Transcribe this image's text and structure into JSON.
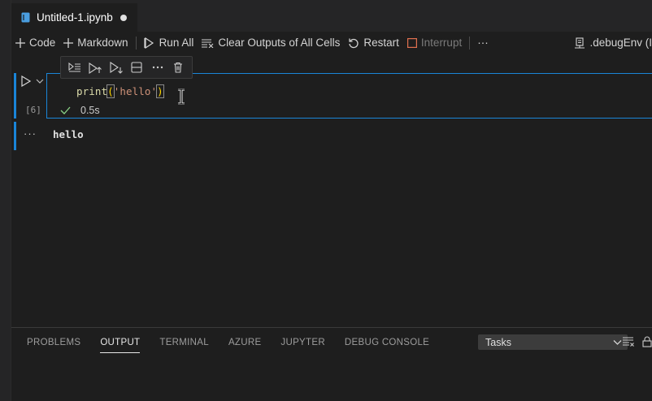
{
  "tab": {
    "title": "Untitled-1.ipynb"
  },
  "toolbar": {
    "code_label": "Code",
    "markdown_label": "Markdown",
    "run_all_label": "Run All",
    "clear_outputs_label": "Clear Outputs of All Cells",
    "restart_label": "Restart",
    "interrupt_label": "Interrupt",
    "more_label": "···",
    "kernel_label": ".debugEnv (I"
  },
  "cell": {
    "code_fn": "print",
    "code_open": "(",
    "code_str": "'hello'",
    "code_close": ")",
    "exec_count": "[6]",
    "duration": "0.5s",
    "output_dots": "···",
    "output": "hello"
  },
  "panel": {
    "tabs": [
      "PROBLEMS",
      "OUTPUT",
      "TERMINAL",
      "AZURE",
      "JUPYTER",
      "DEBUG CONSOLE"
    ],
    "active_tab": "OUTPUT",
    "tasks_value": "Tasks"
  },
  "colors": {
    "accent": "#1a85d8",
    "function": "#dcdcaa",
    "string": "#ce9178",
    "bracket": "#ffd700"
  }
}
